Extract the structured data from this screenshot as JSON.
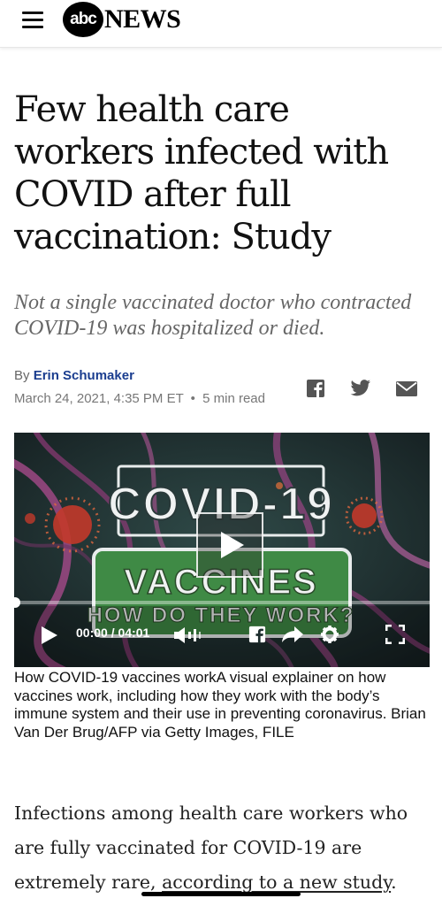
{
  "header": {
    "logo_abc": "abc",
    "logo_news": "NEWS"
  },
  "article": {
    "headline": "Few health care workers infected with COVID after full vaccination: Study",
    "dek": "Not a single vaccinated doctor who contracted COVID-19 was hospitalized or died.",
    "byline_prefix": "By",
    "author": "Erin Schumaker",
    "date": "March 24, 2021, 4:35 PM ET",
    "read_time": "5 min read",
    "share_icons": [
      "facebook-icon",
      "twitter-icon",
      "email-icon"
    ]
  },
  "video": {
    "title_line1": "COVID-19",
    "title_line2": "VACCINES",
    "title_line3": "HOW DO THEY WORK?",
    "time": "00:00 / 04:01",
    "progress": 0
  },
  "caption": "How COVID-19 vaccines workA visual explainer on how vaccines work, including how they work with the body’s immune system and their use in preventing coronavirus. Brian Van Der Brug/AFP via Getty Images, FILE",
  "body": {
    "text_before_link": "Infections among health care workers who are fully vaccinated for COVID-19 are extremely rare, ",
    "link_text": "according to a new study",
    "text_after_link": "."
  },
  "colors": {
    "byline_link": "#1a3d8f",
    "dek_gray": "#666666",
    "video_sign_green": "#3f8a45"
  }
}
